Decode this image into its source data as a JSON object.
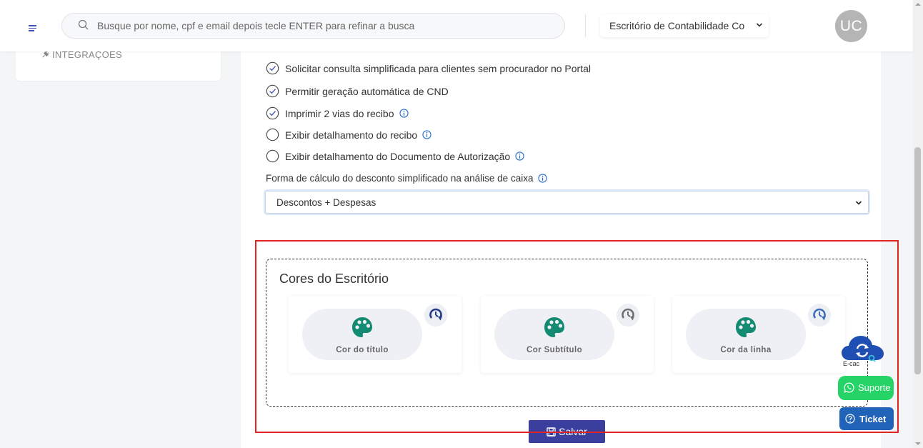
{
  "header": {
    "search_placeholder": "Busque por nome, cpf e email depois tecle ENTER para refinar a busca",
    "office_selected": "Escritório de Contabilidade Co",
    "avatar_initials": "UC"
  },
  "sidebar": {
    "items": [
      {
        "label": "INTEGRAÇÕES"
      }
    ]
  },
  "settings": {
    "options": [
      {
        "label": "Solicitar consulta simplificada para clientes sem procurador no Portal",
        "checked": true
      },
      {
        "label": "Permitir geração automática de CND",
        "checked": true
      },
      {
        "label": "Imprimir 2 vias do recibo",
        "checked": true
      },
      {
        "label": "Exibir detalhamento do recibo",
        "checked": false
      },
      {
        "label": "Exibir detalhamento do Documento de Autorização",
        "checked": false
      }
    ],
    "calc_label": "Forma de cálculo do desconto simplificado na análise de caixa",
    "calc_value": "Descontos + Despesas"
  },
  "colors_section": {
    "title": "Cores do Escritório",
    "cards": [
      {
        "label": "Cor do título",
        "palette_color": "#138a72",
        "reset_color": "#1f3a8a"
      },
      {
        "label": "Cor Subtítulo",
        "palette_color": "#138a72",
        "reset_color": "#707070"
      },
      {
        "label": "Cor da linha",
        "palette_color": "#138a72",
        "reset_color": "#3d6fb8"
      }
    ]
  },
  "actions": {
    "save_label": "Salvar"
  },
  "widgets": {
    "ecac_label": "E-cac",
    "suporte_label": "Suporte",
    "ticket_label": "Ticket"
  },
  "colors": {
    "accent": "#3f51b5",
    "save_button": "#3a3f9e",
    "highlight": "#e02424",
    "whatsapp": "#25d366",
    "ticket": "#2163b8"
  }
}
